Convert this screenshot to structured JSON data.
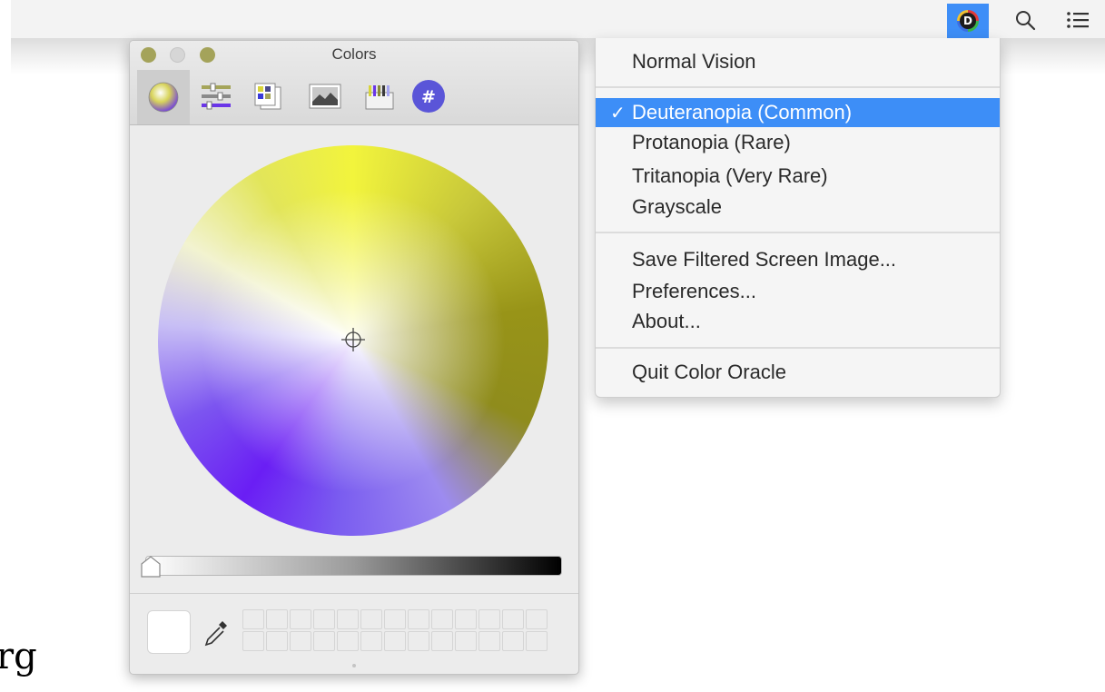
{
  "menubar": {
    "app_icon_letter": "D",
    "icons": [
      "color-oracle-app-icon",
      "search-icon",
      "notification-list-icon"
    ],
    "accent_color": "#3e8ef7"
  },
  "colors_window": {
    "title": "Colors",
    "toolbar_icons": [
      "color-wheel-icon",
      "color-sliders-icon",
      "color-palettes-icon",
      "image-palettes-icon",
      "pencils-icon",
      "hex-input-icon"
    ],
    "hex_tool_label": "#",
    "brightness_level": 0.0,
    "current_color": "#ffffff"
  },
  "menu": {
    "items": [
      {
        "label": "Normal Vision",
        "selected": false
      },
      {
        "label": "Deuteranopia (Common)",
        "selected": true
      },
      {
        "label": "Protanopia (Rare)",
        "selected": false
      },
      {
        "label": "Tritanopia (Very Rare)",
        "selected": false
      },
      {
        "label": "Grayscale",
        "selected": false
      },
      {
        "label": "Save Filtered Screen Image...",
        "selected": false
      },
      {
        "label": "Preferences...",
        "selected": false
      },
      {
        "label": "About...",
        "selected": false
      },
      {
        "label": "Quit Color Oracle",
        "selected": false
      }
    ],
    "check_mark": "✓",
    "selected_color": "#3d8ef7"
  },
  "corner_text": "rg"
}
